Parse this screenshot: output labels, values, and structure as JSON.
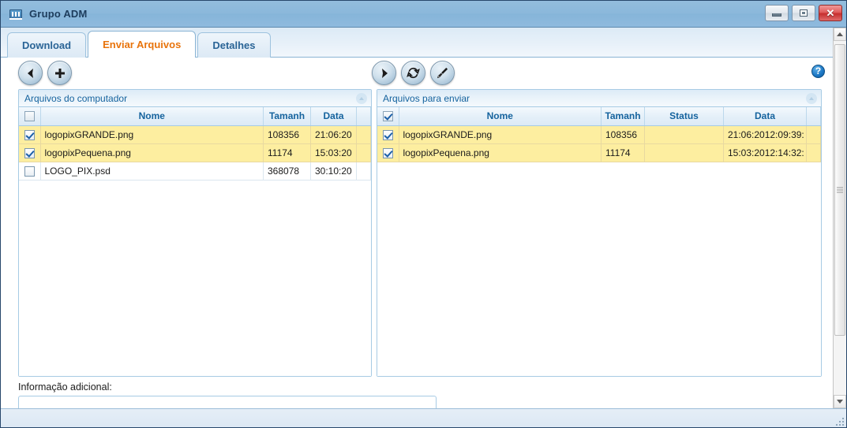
{
  "window": {
    "title": "Grupo ADM",
    "icon": "app-window-icon",
    "buttons": {
      "minimize": "minimize-icon",
      "maximize": "maximize-icon",
      "close": "close-icon",
      "close_glyph": "✕"
    }
  },
  "tabs": [
    {
      "label": "Download",
      "active": false
    },
    {
      "label": "Enviar Arquivos",
      "active": true
    },
    {
      "label": "Detalhes",
      "active": false
    }
  ],
  "toolbar": {
    "left_buttons": [
      {
        "name": "back-button",
        "icon": "left-arrow-icon"
      },
      {
        "name": "add-button",
        "icon": "plus-icon"
      }
    ],
    "right_buttons": [
      {
        "name": "send-button",
        "icon": "play-arrow-icon"
      },
      {
        "name": "refresh-button",
        "icon": "refresh-icon"
      },
      {
        "name": "clear-button",
        "icon": "brush-icon"
      }
    ],
    "help": {
      "name": "help-icon",
      "glyph": "?"
    }
  },
  "left_panel": {
    "title": "Arquivos do computador",
    "columns": [
      "",
      "Nome",
      "Tamanh",
      "Data",
      ""
    ],
    "header_checkbox_checked": false,
    "rows": [
      {
        "checked": true,
        "nome": "logopixGRANDE.png",
        "tamanho": "108356",
        "data": "21:06:20",
        "selected": true
      },
      {
        "checked": true,
        "nome": "logopixPequena.png",
        "tamanho": "11174",
        "data": "15:03:20",
        "selected": true
      },
      {
        "checked": false,
        "nome": "LOGO_PIX.psd",
        "tamanho": "368078",
        "data": "30:10:20",
        "selected": false
      }
    ]
  },
  "right_panel": {
    "title": "Arquivos para enviar",
    "columns": [
      "",
      "Nome",
      "Tamanh",
      "Status",
      "Data",
      ""
    ],
    "header_checkbox_checked": true,
    "rows": [
      {
        "checked": true,
        "nome": "logopixGRANDE.png",
        "tamanho": "108356",
        "status": "",
        "data": "21:06:2012:09:39:",
        "selected": true
      },
      {
        "checked": true,
        "nome": "logopixPequena.png",
        "tamanho": "11174",
        "status": "",
        "data": "15:03:2012:14:32:",
        "selected": true
      }
    ]
  },
  "footer": {
    "additional_info_label": "Informação adicional:",
    "additional_info_value": ""
  },
  "scrollbar": {
    "up_arrow": "scroll-up-icon",
    "down_arrow": "scroll-down-icon"
  },
  "colors": {
    "titlebar": "#8bb8db",
    "tab_active_text": "#e8740c",
    "tab_text": "#2a6496",
    "panel_header_text": "#15639e",
    "row_selected_bg": "#fdeea0",
    "close_button": "#c62f2f",
    "help_blue": "#1a76c4"
  }
}
